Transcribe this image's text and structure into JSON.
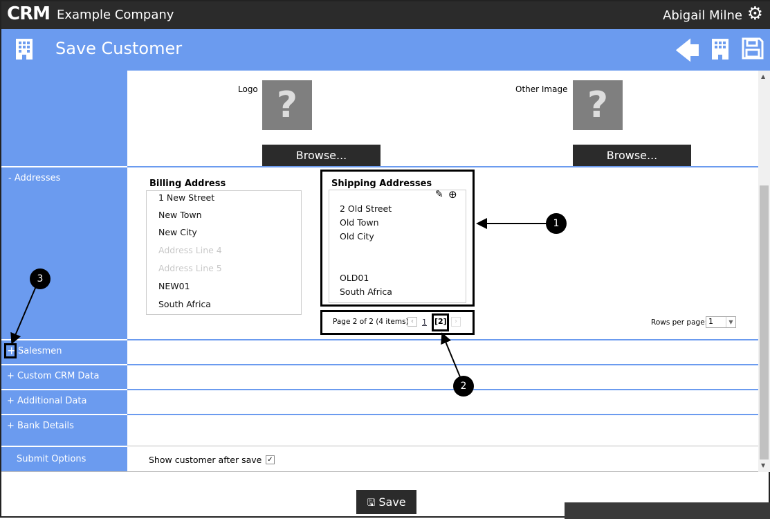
{
  "header": {
    "logo": "CRM",
    "company": "Example Company",
    "user": "Abigail Milne"
  },
  "titlebar": {
    "title": "Save Customer"
  },
  "images": {
    "logo_label": "Logo",
    "other_label": "Other Image",
    "browse": "Browse...",
    "placeholder": "?"
  },
  "sidebar": {
    "addresses": "- Addresses",
    "salesmen": "Salesmen",
    "custom": "+ Custom CRM Data",
    "additional": "+ Additional Data",
    "bank": "+ Bank Details",
    "submit": "Submit Options"
  },
  "billing": {
    "title": "Billing Address",
    "lines": [
      "1 New Street",
      "New Town",
      "New City",
      "Address Line 4",
      "Address Line 5",
      "NEW01",
      "South Africa"
    ]
  },
  "shipping": {
    "title": "Shipping Addresses",
    "lines": [
      "2 Old Street",
      "Old Town",
      "Old City",
      "",
      "",
      "OLD01",
      "South Africa"
    ]
  },
  "pager": {
    "summary": "Page 2 of 2 (4 items)",
    "page1": "1",
    "current": "[2]",
    "rows_label": "Rows per page:",
    "rows_value": "1"
  },
  "submit": {
    "show_after_save": "Show customer after save",
    "checked": true
  },
  "save_button": "Save",
  "annotations": [
    "1",
    "2",
    "3"
  ]
}
